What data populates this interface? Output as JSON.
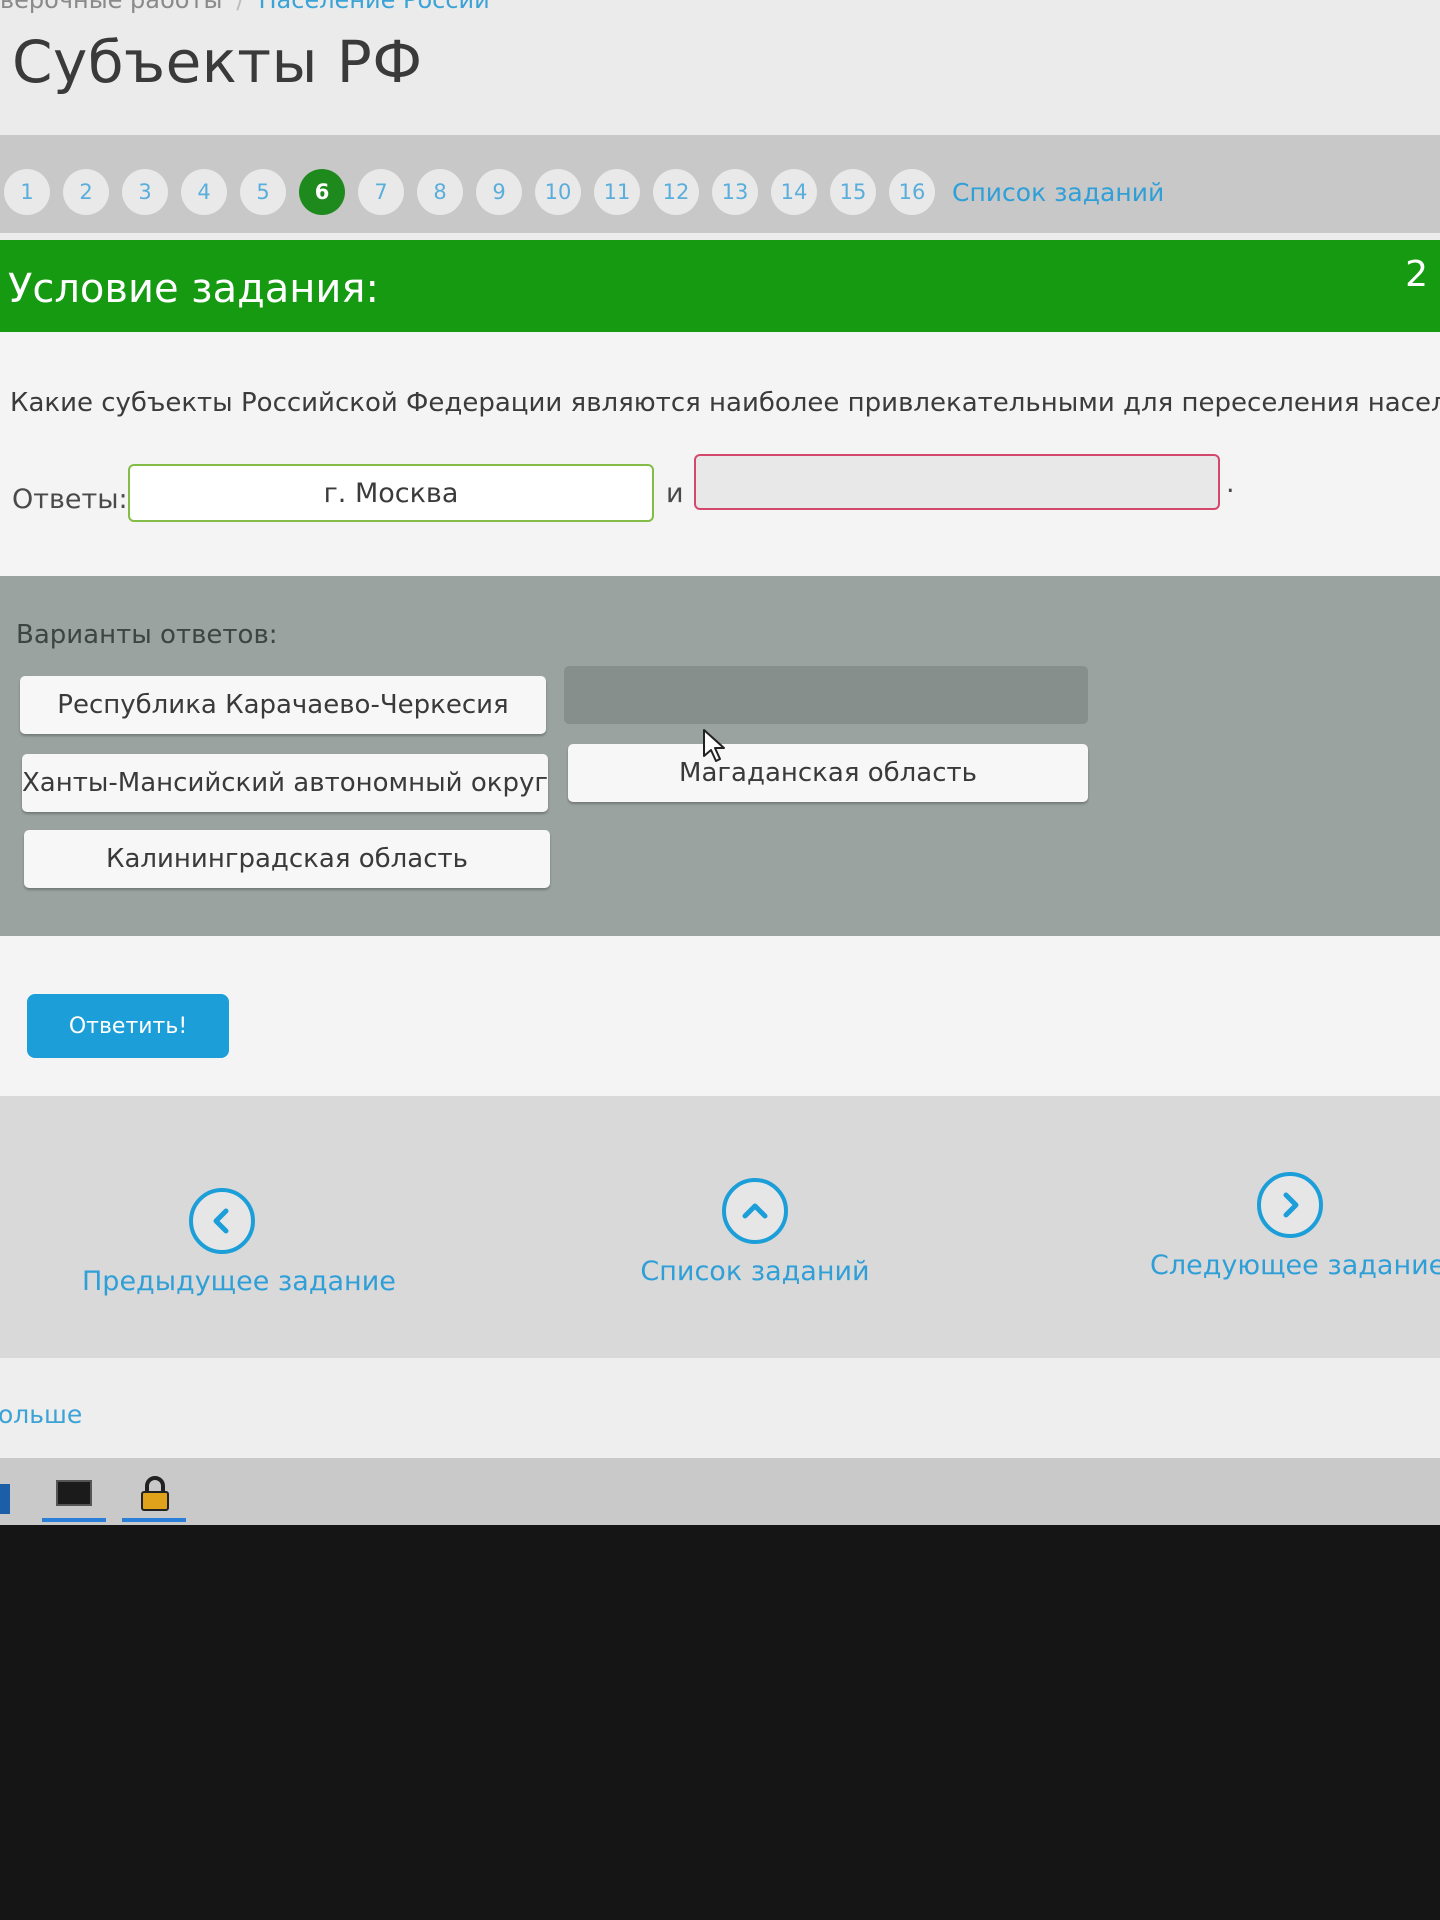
{
  "header": {
    "breadcrumb": [
      "верочные работы",
      "Население России"
    ],
    "breadcrumb_separator": "/",
    "title": "Субъекты РФ"
  },
  "task_nav": {
    "numbers": [
      "1",
      "2",
      "3",
      "4",
      "5",
      "6",
      "7",
      "8",
      "9",
      "10",
      "11",
      "12",
      "13",
      "14",
      "15",
      "16"
    ],
    "active": "6",
    "list_link": "Список заданий"
  },
  "condition": {
    "title": "Условие задания:",
    "score": "2"
  },
  "question": {
    "text": "Какие субъекты Российской Федерации являются наиболее привлекательными для переселения населения?",
    "answers_label": "Ответы:",
    "answer_1": "г. Москва",
    "separator": "и",
    "answer_2": "",
    "period": "."
  },
  "variants": {
    "label": "Варианты ответов:",
    "options": [
      "Республика Карачаево-Черкесия",
      "Ханты-Мансийский автономный округ",
      "Магаданская область",
      "Калининградская область"
    ]
  },
  "submit": {
    "label": "Ответить!"
  },
  "bottom_nav": {
    "prev": "Предыдущее задание",
    "list": "Список заданий",
    "next": "Следующее задание"
  },
  "footer": {
    "more": "ольше"
  },
  "colors": {
    "green_bar": "#159a12",
    "active_dot": "#1e8a1e",
    "link_blue": "#2f9fd8",
    "submit_blue": "#1c9ed8",
    "answer_ok_border": "#84bc48",
    "answer_empty_border": "#d5486e"
  },
  "icons": {
    "prev": "chevron-left-circle-icon",
    "list": "chevron-up-circle-icon",
    "next": "chevron-right-circle-icon",
    "cursor": "mouse-pointer-icon",
    "terminal": "terminal-icon",
    "lock": "padlock-icon"
  }
}
